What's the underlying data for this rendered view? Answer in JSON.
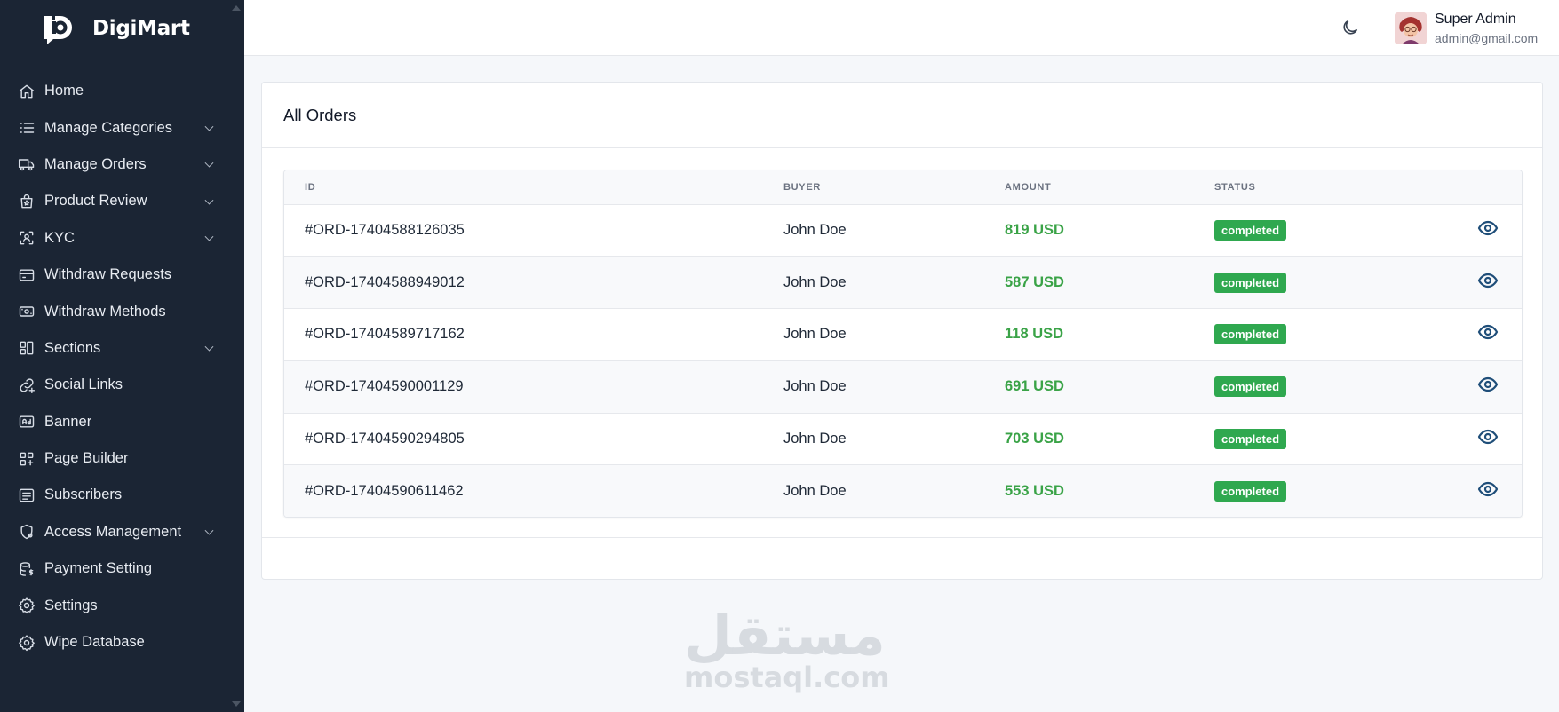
{
  "brand": {
    "name": "DigiMart"
  },
  "sidebar": {
    "items": [
      {
        "label": "Home",
        "icon": "home-icon",
        "has_submenu": false
      },
      {
        "label": "Manage Categories",
        "icon": "list-icon",
        "has_submenu": true
      },
      {
        "label": "Manage Orders",
        "icon": "truck-icon",
        "has_submenu": true
      },
      {
        "label": "Product Review",
        "icon": "bag-star-icon",
        "has_submenu": true
      },
      {
        "label": "KYC",
        "icon": "face-scan-icon",
        "has_submenu": true
      },
      {
        "label": "Withdraw Requests",
        "icon": "credit-card-icon",
        "has_submenu": false
      },
      {
        "label": "Withdraw Methods",
        "icon": "cash-icon",
        "has_submenu": false
      },
      {
        "label": "Sections",
        "icon": "layout-icon",
        "has_submenu": true
      },
      {
        "label": "Social Links",
        "icon": "link-plus-icon",
        "has_submenu": false
      },
      {
        "label": "Banner",
        "icon": "ad-icon",
        "has_submenu": false
      },
      {
        "label": "Page Builder",
        "icon": "grid-plus-icon",
        "has_submenu": false
      },
      {
        "label": "Subscribers",
        "icon": "list-box-icon",
        "has_submenu": false
      },
      {
        "label": "Access Management",
        "icon": "shield-gear-icon",
        "has_submenu": true
      },
      {
        "label": "Payment Setting",
        "icon": "database-dollar-icon",
        "has_submenu": false
      },
      {
        "label": "Settings",
        "icon": "gear-icon",
        "has_submenu": false
      },
      {
        "label": "Wipe Database",
        "icon": "gear-icon",
        "has_submenu": false
      }
    ]
  },
  "header": {
    "theme_toggle_icon": "moon-icon",
    "user": {
      "name": "Super Admin",
      "email": "admin@gmail.com"
    }
  },
  "main": {
    "card_title": "All Orders",
    "table": {
      "columns": [
        "ID",
        "BUYER",
        "AMOUNT",
        "STATUS"
      ],
      "rows": [
        {
          "id": "#ORD-17404588126035",
          "buyer": "John Doe",
          "amount": "819 USD",
          "status": "completed"
        },
        {
          "id": "#ORD-17404588949012",
          "buyer": "John Doe",
          "amount": "587 USD",
          "status": "completed"
        },
        {
          "id": "#ORD-17404589717162",
          "buyer": "John Doe",
          "amount": "118 USD",
          "status": "completed"
        },
        {
          "id": "#ORD-17404590001129",
          "buyer": "John Doe",
          "amount": "691 USD",
          "status": "completed"
        },
        {
          "id": "#ORD-17404590294805",
          "buyer": "John Doe",
          "amount": "703 USD",
          "status": "completed"
        },
        {
          "id": "#ORD-17404590611462",
          "buyer": "John Doe",
          "amount": "553 USD",
          "status": "completed"
        }
      ]
    }
  },
  "watermark": {
    "arabic": "مستقل",
    "latin": "mostaql.com"
  },
  "colors": {
    "sidebar_bg": "#1b2534",
    "amount_green": "#3aa347",
    "badge_green": "#2fa84f",
    "eye_blue": "#1f4e79"
  }
}
